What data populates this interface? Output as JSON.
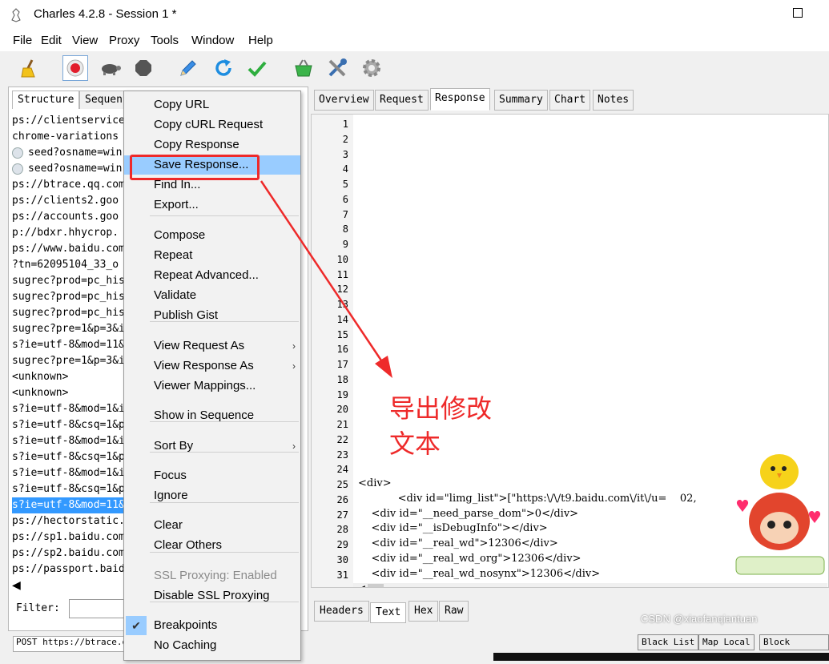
{
  "window": {
    "title": "Charles 4.2.8 - Session 1 *"
  },
  "menubar": [
    "File",
    "Edit",
    "View",
    "Proxy",
    "Tools",
    "Window",
    "Help"
  ],
  "toolbar": {
    "icons": [
      "broom-icon",
      "record-icon",
      "turtle-icon",
      "stop-icon",
      "pen-icon",
      "refresh-icon",
      "check-icon",
      "basket-icon",
      "tools-icon",
      "gear-icon"
    ]
  },
  "left_pane": {
    "tabs": [
      "Structure",
      "Sequen"
    ],
    "rows": [
      "ps://clientservice",
      "chrome-variations",
      "seed?osname=win",
      "seed?osname=win",
      "ps://btrace.qq.com",
      "ps://clients2.goo",
      "ps://accounts.goo",
      "p://bdxr.hhycrop.",
      "ps://www.baidu.com",
      "?tn=62095104_33_o",
      "sugrec?prod=pc_his",
      "sugrec?prod=pc_his",
      "sugrec?prod=pc_his",
      "sugrec?pre=1&p=3&i",
      "s?ie=utf-8&mod=11&",
      "sugrec?pre=1&p=3&i",
      "<unknown>",
      "<unknown>",
      "s?ie=utf-8&mod=1&i",
      "s?ie=utf-8&csq=1&p",
      "s?ie=utf-8&mod=1&i",
      "s?ie=utf-8&csq=1&p",
      "s?ie=utf-8&mod=1&i",
      "s?ie=utf-8&csq=1&p",
      "s?ie=utf-8&mod=11&",
      "ps://hectorstatic.",
      "ps://sp1.baidu.com",
      "ps://sp2.baidu.com",
      "ps://passport.baid"
    ],
    "selected_index": 24,
    "filter_label": "Filter:"
  },
  "context_menu": {
    "items": [
      {
        "label": "Copy URL"
      },
      {
        "label": "Copy cURL Request"
      },
      {
        "label": "Copy Response"
      },
      {
        "label": "Save Response...",
        "highlighted": true
      },
      {
        "label": "Find In..."
      },
      {
        "label": "Export..."
      },
      {
        "label": "Compose"
      },
      {
        "label": "Repeat"
      },
      {
        "label": "Repeat Advanced..."
      },
      {
        "label": "Validate"
      },
      {
        "label": "Publish Gist"
      },
      {
        "label": "View Request As",
        "submenu": true
      },
      {
        "label": "View Response As",
        "submenu": true
      },
      {
        "label": "Viewer Mappings..."
      },
      {
        "label": "Show in Sequence"
      },
      {
        "label": "Sort By",
        "submenu": true
      },
      {
        "label": "Focus"
      },
      {
        "label": "Ignore"
      },
      {
        "label": "Clear"
      },
      {
        "label": "Clear Others"
      },
      {
        "label": "SSL Proxying: Enabled",
        "disabled": true
      },
      {
        "label": "Disable SSL Proxying"
      },
      {
        "label": "Breakpoints",
        "checked": true
      },
      {
        "label": "No Caching"
      }
    ]
  },
  "right_pane": {
    "tabs": [
      "Overview",
      "Request",
      "Response",
      "Summary",
      "Chart",
      "Notes"
    ],
    "active_tab": "Response",
    "line_numbers": [
      "1",
      "2",
      "3",
      "4",
      "5",
      "6",
      "7",
      "8",
      "9",
      "10",
      "11",
      "12",
      "13",
      "14",
      "15",
      "16",
      "17",
      "18",
      "19",
      "20",
      "21",
      "22",
      "23",
      "24",
      "25",
      "26",
      "27",
      "28",
      "29",
      "30",
      "31"
    ],
    "code_lines": [
      {
        "line": "25",
        "text": "<div>"
      },
      {
        "line": "26",
        "text": "            <div id=\"limg_list\">[\"https:\\/\\/t9.baidu.com\\/it\\/u=    02,"
      },
      {
        "line": "27",
        "text": "    <div id=\"__need_parse_dom\">0</div>"
      },
      {
        "line": "28",
        "text": "    <div id=\"__isDebugInfo\"></div>"
      },
      {
        "line": "29",
        "text": "    <div id=\"__real_wd\">12306</div>"
      },
      {
        "line": "30",
        "text": "    <div id=\"__real_wd_org\">12306</div>"
      },
      {
        "line": "31",
        "text": "    <div id=\"__real_wd_nosynx\">12306</div>"
      }
    ],
    "bottom_tabs": [
      "Headers",
      "Text",
      "Hex",
      "Raw"
    ],
    "active_bottom_tab": "Text"
  },
  "status_bar": {
    "text": "POST https://btrace.qq.",
    "buttons": [
      "Black List",
      "Map Local",
      "Block Cookies"
    ]
  },
  "annotation": {
    "text_line1": "导出修改",
    "text_line2": "文本",
    "color": "#ee2a2a"
  },
  "watermark": "CSDN @xiaofanqiantuan",
  "colors": {
    "selection": "#3399ff",
    "menu_highlight": "#99ccff",
    "annotation": "#ee2a2a"
  }
}
